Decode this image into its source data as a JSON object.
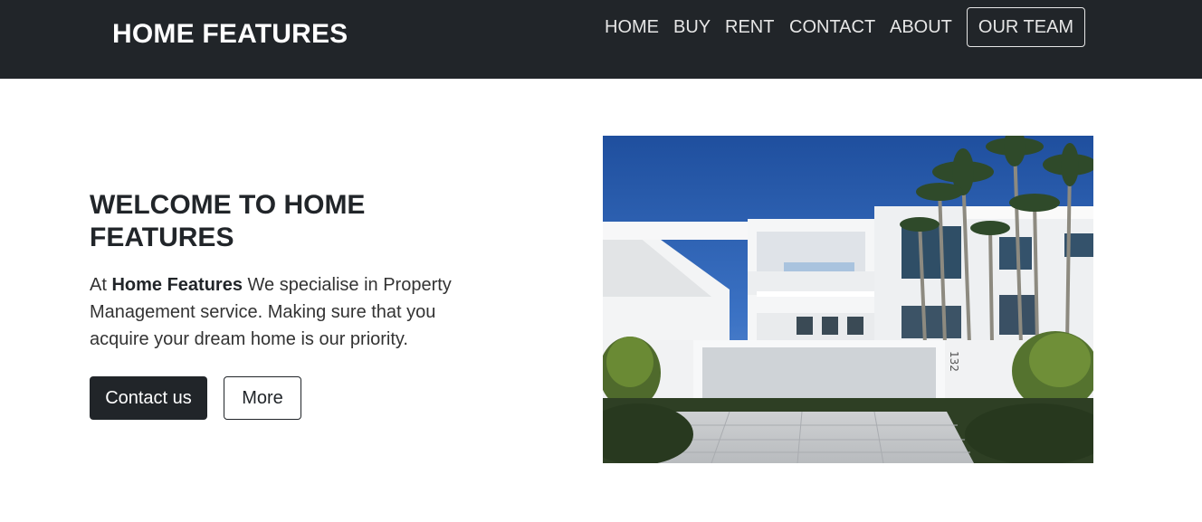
{
  "navbar": {
    "brand": "HOME FEATURES",
    "links": [
      {
        "label": "HOME"
      },
      {
        "label": "BUY"
      },
      {
        "label": "RENT"
      },
      {
        "label": "CONTACT"
      },
      {
        "label": "ABOUT"
      }
    ],
    "team_button": "OUR TEAM"
  },
  "hero": {
    "title": "WELCOME TO HOME FEATURES",
    "text_prefix": "At ",
    "text_bold": "Home Features",
    "text_suffix": " We specialise in Property Management service. Making sure that you acquire your dream home is our priority.",
    "contact_button": "Contact us",
    "more_button": "More",
    "house_number": "132"
  },
  "colors": {
    "navbar_bg": "#212529",
    "nav_text": "#e6e6e6",
    "primary_button": "#212529"
  },
  "image": {
    "icon": "modern-white-villa-photo"
  }
}
